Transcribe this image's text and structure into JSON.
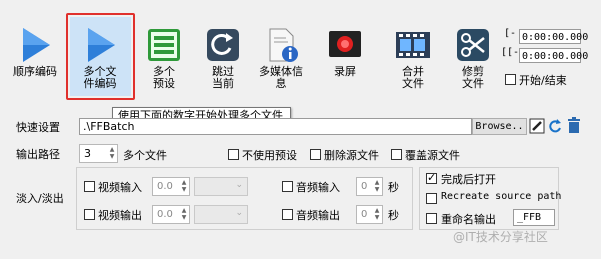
{
  "toolbar": {
    "items": [
      {
        "label": "顺序编码",
        "icon": "play-icon"
      },
      {
        "label": "多个文件编码",
        "icon": "play-icon"
      },
      {
        "label": "多个预设",
        "icon": "film-preset-icon"
      },
      {
        "label": "跳过当前",
        "icon": "skip-icon"
      },
      {
        "label": "多媒体信息",
        "icon": "info-icon"
      },
      {
        "label": "录屏",
        "icon": "record-icon"
      },
      {
        "label": "合并文件",
        "icon": "filmstrip-icon"
      },
      {
        "label": "修剪文件",
        "icon": "scissors-icon"
      }
    ]
  },
  "time": {
    "start_bracket": "[-",
    "end_bracket": "[[-",
    "start_value": "0:00:00.000",
    "end_value": "0:00:00.000",
    "start_end_label": "开始/结束"
  },
  "tooltip": "使用下面的数字开始处理多个文件",
  "settings": {
    "quick_label": "快速设置",
    "path_value": ".\\FFBatch",
    "browse_label": "Browse..",
    "output_label": "输出路径",
    "multi_count": "3",
    "multi_label": "多个文件",
    "no_preset_label": "不使用预设",
    "delete_source_label": "删除源文件",
    "overwrite_source_label": "覆盖源文件"
  },
  "fade": {
    "label": "淡入/淡出",
    "video_in": "视频输入",
    "video_out": "视频输出",
    "audio_in": "音频输入",
    "audio_out": "音频输出",
    "video_in_value": "0.0",
    "video_out_value": "0.0",
    "audio_in_value": "0",
    "audio_out_value": "0",
    "seconds": "秒"
  },
  "after": {
    "open_when_done": "完成后打开",
    "recreate_path": "Recreate source path",
    "rename_output": "重命名输出",
    "rename_suffix": "_FFB"
  },
  "watermark": "@IT技术分享社区",
  "colors": {
    "highlight": "#e0302c",
    "selection": "#cde3f7"
  }
}
